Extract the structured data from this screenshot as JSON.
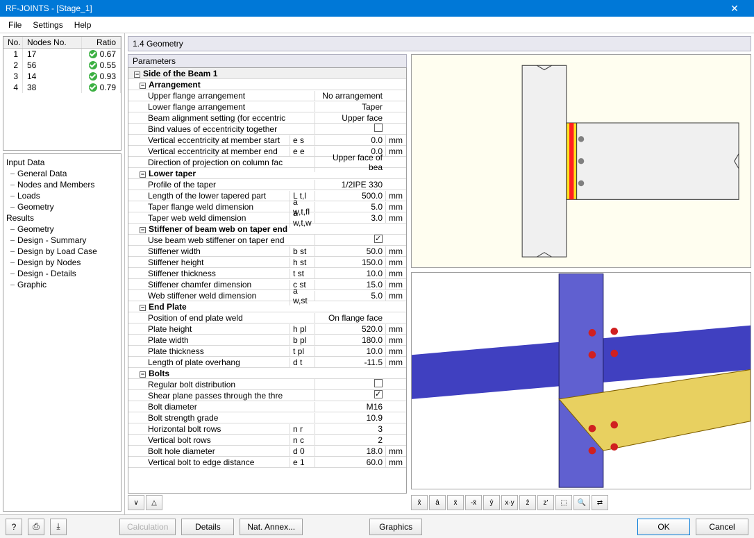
{
  "window": {
    "title": "RF-JOINTS - [Stage_1]",
    "close": "✕"
  },
  "menu": [
    "File",
    "Settings",
    "Help"
  ],
  "nodesTable": {
    "headers": [
      "No.",
      "Nodes No.",
      "Ratio"
    ],
    "rows": [
      {
        "no": "1",
        "nodes": "17",
        "ratio": "0.67"
      },
      {
        "no": "2",
        "nodes": "56",
        "ratio": "0.55"
      },
      {
        "no": "3",
        "nodes": "14",
        "ratio": "0.93"
      },
      {
        "no": "4",
        "nodes": "38",
        "ratio": "0.79"
      }
    ]
  },
  "tree": {
    "inputData": "Input Data",
    "generalData": "General Data",
    "nodesMembers": "Nodes and Members",
    "loads": "Loads",
    "geometry": "Geometry",
    "results": "Results",
    "rGeometry": "Geometry",
    "designSummary": "Design - Summary",
    "designByLC": "Design by Load Case",
    "designByNodes": "Design by Nodes",
    "designDetails": "Design - Details",
    "graphic": "Graphic"
  },
  "panelTitle": "1.4 Geometry",
  "paramsHeader": "Parameters",
  "groups": {
    "sideBeam": "Side of the Beam 1",
    "arrangement": "Arrangement",
    "lowerTaper": "Lower taper",
    "stiffener": "Stiffener of beam web on taper end",
    "endPlate": "End Plate",
    "bolts": "Bolts"
  },
  "params": [
    {
      "n": "Upper flange arrangement",
      "s": "",
      "v": "No arrangement",
      "u": ""
    },
    {
      "n": "Lower flange arrangement",
      "s": "",
      "v": "Taper",
      "u": ""
    },
    {
      "n": "Beam alignment setting (for eccentric",
      "s": "",
      "v": "Upper face",
      "u": ""
    },
    {
      "n": "Bind values of eccentricity together",
      "s": "",
      "v": "__chk_off",
      "u": ""
    },
    {
      "n": "Vertical eccentricity at member start",
      "s": "e s",
      "v": "0.0",
      "u": "mm"
    },
    {
      "n": "Vertical eccentricity at member end",
      "s": "e e",
      "v": "0.0",
      "u": "mm"
    },
    {
      "n": "Direction of projection on column fac",
      "s": "",
      "v": "Upper face of bea",
      "u": ""
    },
    {
      "n": "Profile of the taper",
      "s": "",
      "v": "1/2IPE 330",
      "u": ""
    },
    {
      "n": "Length of the lower tapered part",
      "s": "L t,l",
      "v": "500.0",
      "u": "mm"
    },
    {
      "n": "Taper flange weld dimension",
      "s": "a w,t,fl",
      "v": "5.0",
      "u": "mm"
    },
    {
      "n": "Taper web weld dimension",
      "s": "a w,t,w",
      "v": "3.0",
      "u": "mm"
    },
    {
      "n": "Use beam web stiffener on taper end",
      "s": "",
      "v": "__chk_on",
      "u": ""
    },
    {
      "n": "Stiffener width",
      "s": "b st",
      "v": "50.0",
      "u": "mm"
    },
    {
      "n": "Stiffener height",
      "s": "h st",
      "v": "150.0",
      "u": "mm"
    },
    {
      "n": "Stiffener thickness",
      "s": "t st",
      "v": "10.0",
      "u": "mm"
    },
    {
      "n": "Stiffener chamfer dimension",
      "s": "c st",
      "v": "15.0",
      "u": "mm"
    },
    {
      "n": "Web stiffener weld dimension",
      "s": "a w,st",
      "v": "5.0",
      "u": "mm"
    },
    {
      "n": "Position of end plate weld",
      "s": "",
      "v": "On flange face",
      "u": ""
    },
    {
      "n": "Plate height",
      "s": "h pl",
      "v": "520.0",
      "u": "mm"
    },
    {
      "n": "Plate width",
      "s": "b pl",
      "v": "180.0",
      "u": "mm"
    },
    {
      "n": "Plate thickness",
      "s": "t pl",
      "v": "10.0",
      "u": "mm"
    },
    {
      "n": "Length of plate overhang",
      "s": "d t",
      "v": "-11.5",
      "u": "mm"
    },
    {
      "n": "Regular bolt distribution",
      "s": "",
      "v": "__chk_off",
      "u": ""
    },
    {
      "n": "Shear plane passes through the thre",
      "s": "",
      "v": "__chk_on",
      "u": ""
    },
    {
      "n": "Bolt diameter",
      "s": "",
      "v": "M16",
      "u": ""
    },
    {
      "n": "Bolt strength grade",
      "s": "",
      "v": "10.9",
      "u": ""
    },
    {
      "n": "Horizontal bolt rows",
      "s": "n r",
      "v": "3",
      "u": ""
    },
    {
      "n": "Vertical bolt rows",
      "s": "n c",
      "v": "2",
      "u": ""
    },
    {
      "n": "Bolt hole diameter",
      "s": "d 0",
      "v": "18.0",
      "u": "mm"
    },
    {
      "n": "Vertical bolt to edge distance",
      "s": "e 1",
      "v": "60.0",
      "u": "mm"
    }
  ],
  "viewTools": [
    "x̂",
    "â",
    "x̄",
    "-x̄",
    "ŷ",
    "x·y",
    "ẑ",
    "z'",
    "⬚",
    "🔍",
    "⇄"
  ],
  "paramTools": [
    "∨",
    "△"
  ],
  "bottom": {
    "calculation": "Calculation",
    "details": "Details",
    "natAnnex": "Nat. Annex...",
    "graphics": "Graphics",
    "ok": "OK",
    "cancel": "Cancel"
  }
}
